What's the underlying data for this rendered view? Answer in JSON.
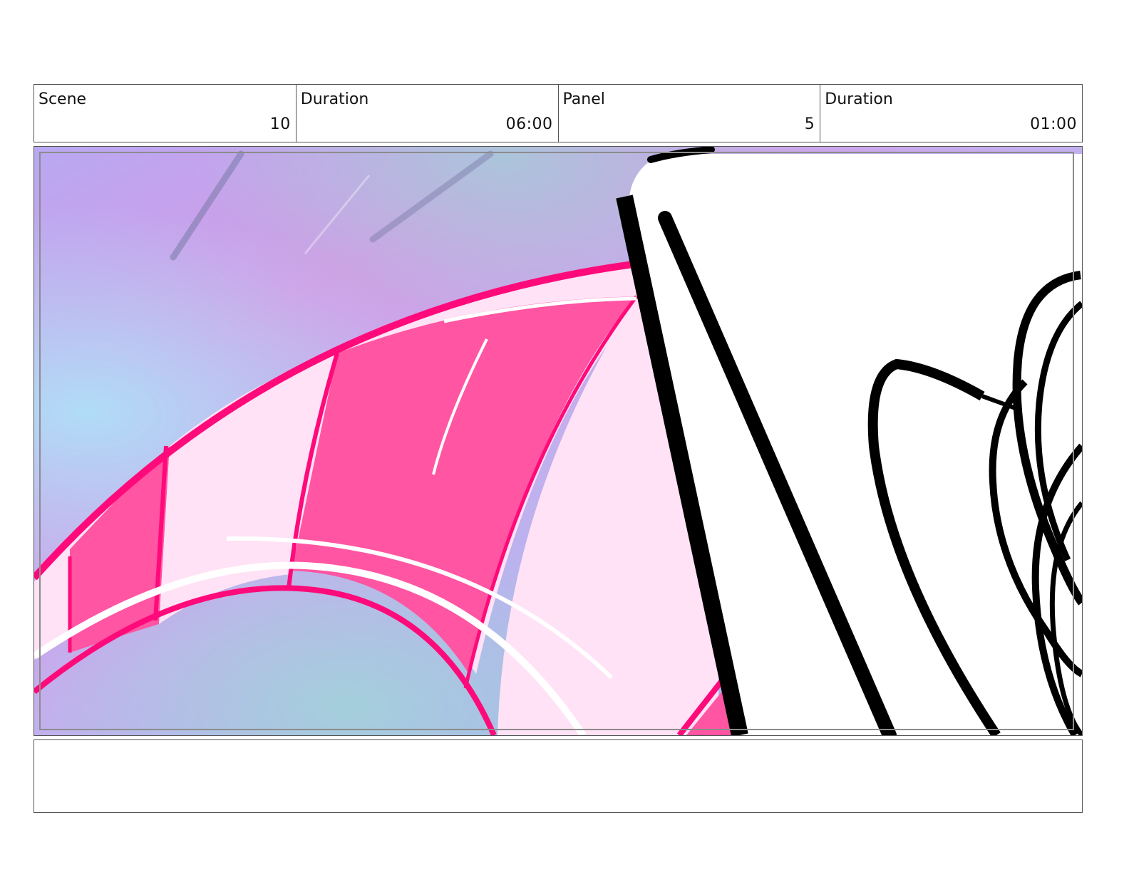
{
  "header": {
    "scene_label": "Scene",
    "scene_value": "10",
    "scene_duration_label": "Duration",
    "scene_duration_value": "06:00",
    "panel_label": "Panel",
    "panel_value": "5",
    "panel_duration_label": "Duration",
    "panel_duration_value": "01:00"
  },
  "panel_image": {
    "description_icon": "storyboard-drawing",
    "colors": {
      "pink_dark": "#ff0a7a",
      "pink_mid": "#ff55a2",
      "pink_light": "#ffe2f5",
      "sky_violet": "#c9a0ee",
      "sky_blue": "#aee0f8",
      "ink": "#000000"
    }
  },
  "notes": {
    "text": ""
  }
}
